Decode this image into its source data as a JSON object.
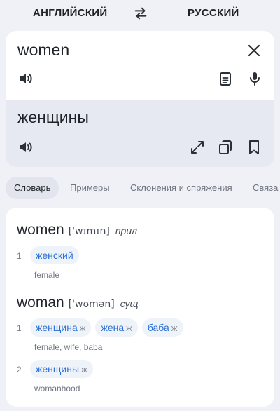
{
  "languages": {
    "source": "АНГЛИЙСКИЙ",
    "target": "РУССКИЙ"
  },
  "input": {
    "text": "women"
  },
  "output": {
    "text": "женщины"
  },
  "tabs": [
    {
      "label": "Словарь"
    },
    {
      "label": "Примеры"
    },
    {
      "label": "Склонения и спряжения"
    },
    {
      "label": "Связа"
    }
  ],
  "dictionary": {
    "entries": [
      {
        "headword": "women",
        "transcription": "['wɪmɪn]",
        "pos": "прил",
        "senses": [
          {
            "num": "1",
            "translations": [
              {
                "word": "женский",
                "gender": ""
              }
            ],
            "gloss": "female"
          }
        ]
      },
      {
        "headword": "woman",
        "transcription": "['wʊmən]",
        "pos": "сущ",
        "senses": [
          {
            "num": "1",
            "translations": [
              {
                "word": "женщина",
                "gender": "ж"
              },
              {
                "word": "жена",
                "gender": "ж"
              },
              {
                "word": "баба",
                "gender": "ж"
              }
            ],
            "gloss": "female, wife, baba"
          },
          {
            "num": "2",
            "translations": [
              {
                "word": "женщины",
                "gender": "ж"
              }
            ],
            "gloss": "womanhood"
          }
        ]
      }
    ]
  },
  "icons": {
    "swap": "swap-arrows-icon",
    "clear": "close-icon",
    "speak": "speaker-icon",
    "paste": "clipboard-icon",
    "mic": "microphone-icon",
    "expand": "expand-icon",
    "copy": "copy-icon",
    "bookmark": "bookmark-icon"
  },
  "colors": {
    "accent": "#2a6fd6",
    "background": "#eff1f6",
    "card": "#ffffff",
    "output_card": "#e7e9f2"
  }
}
